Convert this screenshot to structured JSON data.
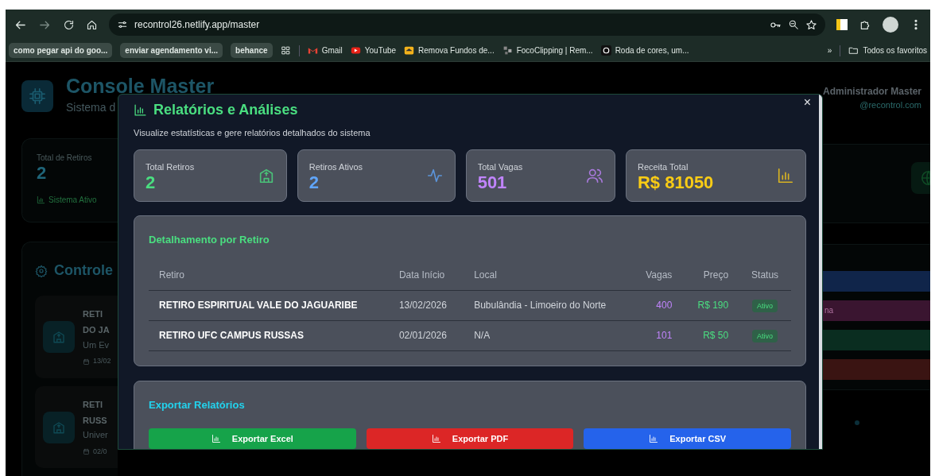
{
  "browser": {
    "address": "recontrol26.netlify.app/master",
    "bookmarks": [
      {
        "label": "como pegar api do goo...",
        "kind": "chip"
      },
      {
        "label": "enviar agendamento vi...",
        "kind": "chip"
      },
      {
        "label": "behance",
        "kind": "chip"
      },
      {
        "label": "Gmail",
        "kind": "gmail"
      },
      {
        "label": "YouTube",
        "kind": "youtube"
      },
      {
        "label": "Remova Fundos de...",
        "kind": "photo"
      },
      {
        "label": "FocoClipping | Rem...",
        "kind": "clip"
      },
      {
        "label": "Roda de cores, um...",
        "kind": "wheel"
      }
    ],
    "overflow": "»",
    "all_bookmarks": "Todos os favoritos"
  },
  "background": {
    "title": "Console Master",
    "subtitle": "Sistema d",
    "user_name": "Administrador Master",
    "user_email": "@recontrol.com",
    "stat": {
      "label": "Total de Retiros",
      "value": "2",
      "footer": "Sistema Ativo"
    },
    "section_title": "Controle",
    "retreat_cards": [
      {
        "title_lines": [
          "RETI",
          "DO JA"
        ],
        "description": "Um Ev",
        "date": "13/02"
      },
      {
        "title_lines": [
          "RETI",
          "RUSS"
        ],
        "description": "Univer",
        "date": "02/0"
      }
    ],
    "action_bars": [
      {
        "color": "#10254a"
      },
      {
        "label": "na",
        "color": "#3a1530"
      },
      {
        "color": "#0a2d20"
      },
      {
        "color": "#3a1412"
      }
    ]
  },
  "modal": {
    "title": "Relatórios e Análises",
    "subtitle": "Visualize estatísticas e gere relatórios detalhados do sistema",
    "close": "×",
    "stats": [
      {
        "label": "Total Retiros",
        "value": "2",
        "color": "#4ade80"
      },
      {
        "label": "Retiros Ativos",
        "value": "2",
        "color": "#60a5fa"
      },
      {
        "label": "Total Vagas",
        "value": "501",
        "color": "#c084fc"
      },
      {
        "label": "Receita Total",
        "value": "R$ 81050",
        "color": "#facc15"
      }
    ],
    "detail": {
      "title": "Detalhamento por Retiro",
      "columns": [
        "Retiro",
        "Data Início",
        "Local",
        "Vagas",
        "Preço",
        "Status"
      ],
      "rows": [
        {
          "retiro": "RETIRO ESPIRITUAL VALE DO JAGUARIBE",
          "data": "13/02/2026",
          "local": "Bubulândia - Limoeiro do Norte",
          "vagas": "400",
          "preco": "R$ 190",
          "status": "Ativo"
        },
        {
          "retiro": "RETIRO UFC CAMPUS RUSSAS",
          "data": "02/01/2026",
          "local": "N/A",
          "vagas": "101",
          "preco": "R$ 50",
          "status": "Ativo"
        }
      ]
    },
    "export": {
      "title": "Exportar Relatórios",
      "buttons": [
        {
          "label": "Exportar Excel",
          "color": "#16a34a"
        },
        {
          "label": "Exportar PDF",
          "color": "#dc2626"
        },
        {
          "label": "Exportar CSV",
          "color": "#2563eb"
        }
      ]
    }
  }
}
